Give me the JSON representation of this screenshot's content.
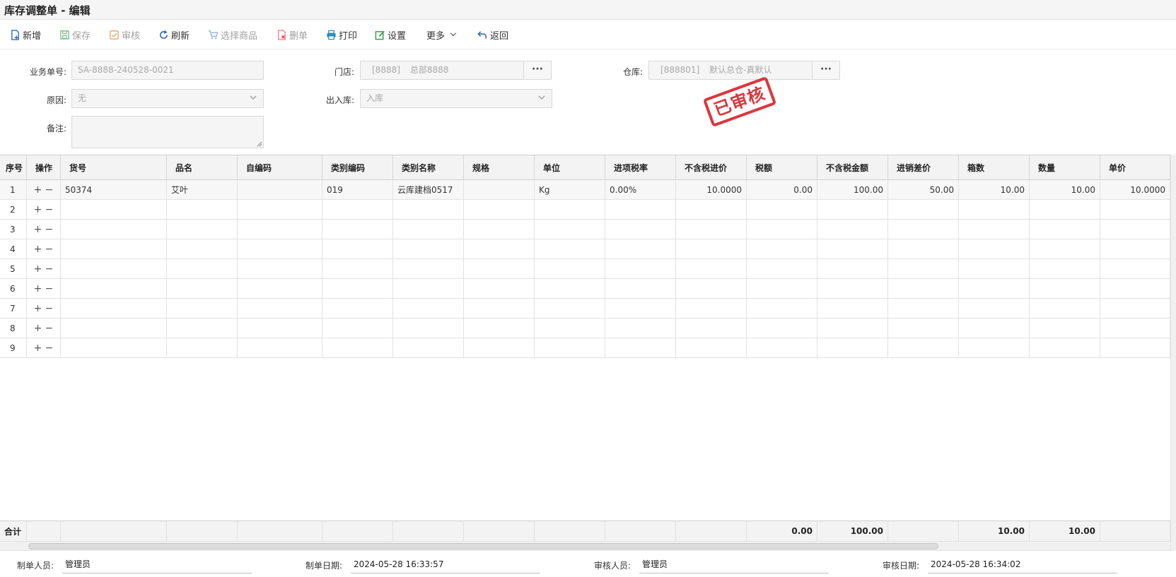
{
  "window": {
    "title": "库存调整单 - 编辑"
  },
  "toolbar": {
    "new": "新增",
    "save": "保存",
    "audit": "审核",
    "refresh": "刷新",
    "select_goods": "选择商品",
    "delete": "删单",
    "print": "打印",
    "settings": "设置",
    "more": "更多",
    "back": "返回"
  },
  "form": {
    "doc_no_label": "业务单号:",
    "doc_no_value": "SA-8888-240528-0021",
    "store_label": "门店:",
    "store_code": "[8888]",
    "store_name": "总部8888",
    "warehouse_label": "仓库:",
    "warehouse_code": "[888801]",
    "warehouse_name": "默认总仓-真默认",
    "ellipsis": "···",
    "reason_label": "原因:",
    "reason_value": "无",
    "io_label": "出入库:",
    "io_value": "入库",
    "remark_label": "备注:",
    "remark_value": ""
  },
  "stamp": {
    "text": "已审核"
  },
  "grid": {
    "columns": [
      "序号",
      "操作",
      "货号",
      "品名",
      "自编码",
      "类别编码",
      "类别名称",
      "规格",
      "单位",
      "进项税率",
      "不含税进价",
      "税额",
      "不含税金额",
      "进销差价",
      "箱数",
      "数量",
      "单价"
    ],
    "ops": {
      "add": "+",
      "remove": "−"
    },
    "rows": [
      {
        "seq": "1",
        "code": "50374",
        "name": "艾叶",
        "self_code": "",
        "cat_code": "019",
        "cat_name": "云库建档0517",
        "spec": "",
        "unit": "Kg",
        "tax_rate": "0.00%",
        "price_ex": "10.0000",
        "tax": "0.00",
        "amount_ex": "100.00",
        "diff": "50.00",
        "boxes": "10.00",
        "qty": "10.00",
        "unit_price": "10.0000"
      },
      {
        "seq": "2"
      },
      {
        "seq": "3"
      },
      {
        "seq": "4"
      },
      {
        "seq": "5"
      },
      {
        "seq": "6"
      },
      {
        "seq": "7"
      },
      {
        "seq": "8"
      },
      {
        "seq": "9"
      }
    ],
    "footer": {
      "label": "合计",
      "tax": "0.00",
      "amount_ex": "100.00",
      "boxes": "10.00",
      "qty": "10.00"
    }
  },
  "info": {
    "creator_label": "制单人员:",
    "creator": "管理员",
    "create_date_label": "制单日期:",
    "create_date": "2024-05-28 16:33:57",
    "auditor_label": "审核人员:",
    "auditor": "管理员",
    "audit_date_label": "审核日期:",
    "audit_date": "2024-05-28 16:34:02"
  },
  "colors": {
    "stamp": "#d9262e",
    "icon_blue": "#2f6fc4",
    "icon_green": "#2e9b48",
    "icon_orange": "#e0803a",
    "icon_red": "#e0454a"
  }
}
